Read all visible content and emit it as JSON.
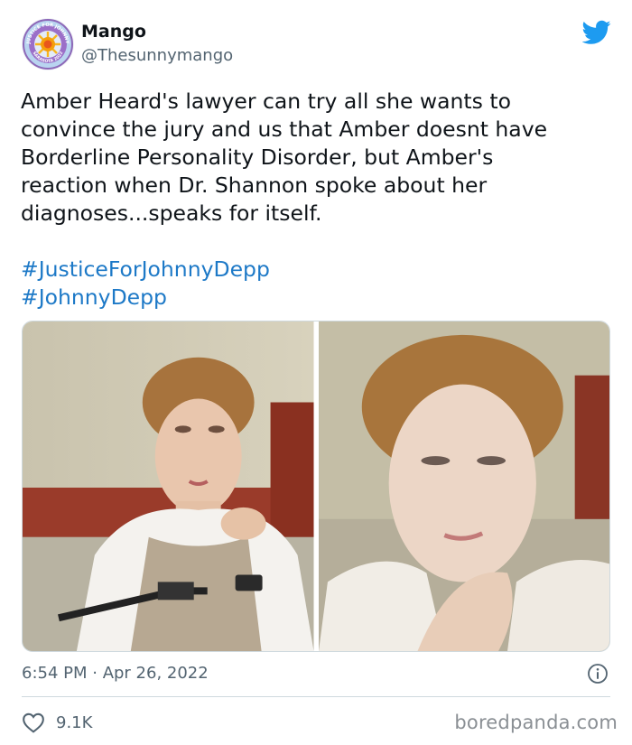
{
  "author": {
    "display_name": "Mango",
    "handle": "@Thesunnymango",
    "avatar_badge_text": "JUSTICE FOR JOHNNY",
    "avatar_badge_bottom": "SARASOTA 2022"
  },
  "tweet": {
    "text_lines": [
      "Amber Heard's lawyer can try all she wants to",
      "convince the jury and us that Amber doesnt have",
      "Borderline Personality Disorder, but Amber's",
      "reaction when Dr. Shannon spoke about her",
      "diagnoses...speaks for itself."
    ],
    "hashtags": [
      "#JusticeForJohnnyDepp",
      "#JohnnyDepp"
    ],
    "timestamp": "6:54 PM · Apr 26, 2022",
    "like_count": "9.1K"
  },
  "icons": {
    "brand": "twitter-bird-icon",
    "info": "info-icon",
    "like": "heart-icon"
  },
  "colors": {
    "twitter_blue": "#1d9bf0",
    "hashtag": "#1d79c7",
    "secondary_text": "#536471",
    "divider": "#cfd9de"
  },
  "watermark": "boredpanda.com"
}
